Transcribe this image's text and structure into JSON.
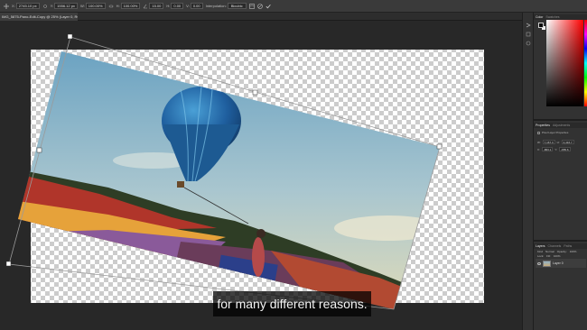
{
  "options_bar": {
    "x_label": "X:",
    "x_value": "2745.10 px",
    "y_label": "Y:",
    "y_value": "1556.12 px",
    "w_label": "W:",
    "w_value": "100.00%",
    "h_label": "H:",
    "h_value": "100.00%",
    "angle_value": "15.00",
    "hskew_value": "0.00",
    "vskew_value": "0.00",
    "interpolation_label": "Interpolation:",
    "interpolation_value": "Bicubic"
  },
  "document_tab": {
    "label": "IMG_5875-Pano-Edit-Copy @ 25% (Layer 0, RGB/8) *"
  },
  "color_panel": {
    "tabs": [
      "Color",
      "Swatches"
    ],
    "active_tab": 0
  },
  "properties_panel": {
    "tabs": [
      "Properties",
      "Adjustments"
    ],
    "layer_type": "Pixel Layer Properties",
    "w_label": "W:",
    "w_value": "7,167.3",
    "h_label": "H:",
    "h_value": "4,416.7",
    "x_label": "X:",
    "x_value": "-863.1",
    "y_label": "Y:",
    "y_value": "-655.6"
  },
  "layers_panel": {
    "tabs": [
      "Layers",
      "Channels",
      "Paths"
    ],
    "kind_label": "Kind",
    "blend_mode": "Normal",
    "opacity_label": "Opacity:",
    "opacity_value": "100%",
    "lock_label": "Lock:",
    "fill_label": "Fill:",
    "fill_value": "100%",
    "layer_name": "Layer 0"
  },
  "caption": {
    "text": "for many different reasons."
  },
  "colors": {
    "sky_top": "#5e9bbf",
    "sky_bottom": "#e9dfb5",
    "balloon_blue": "#1f5f9f",
    "balloon_light": "#4aa0d6",
    "field_red": "#b0352a",
    "field_purple": "#8a5a9a",
    "field_yellow": "#e6a23a"
  }
}
